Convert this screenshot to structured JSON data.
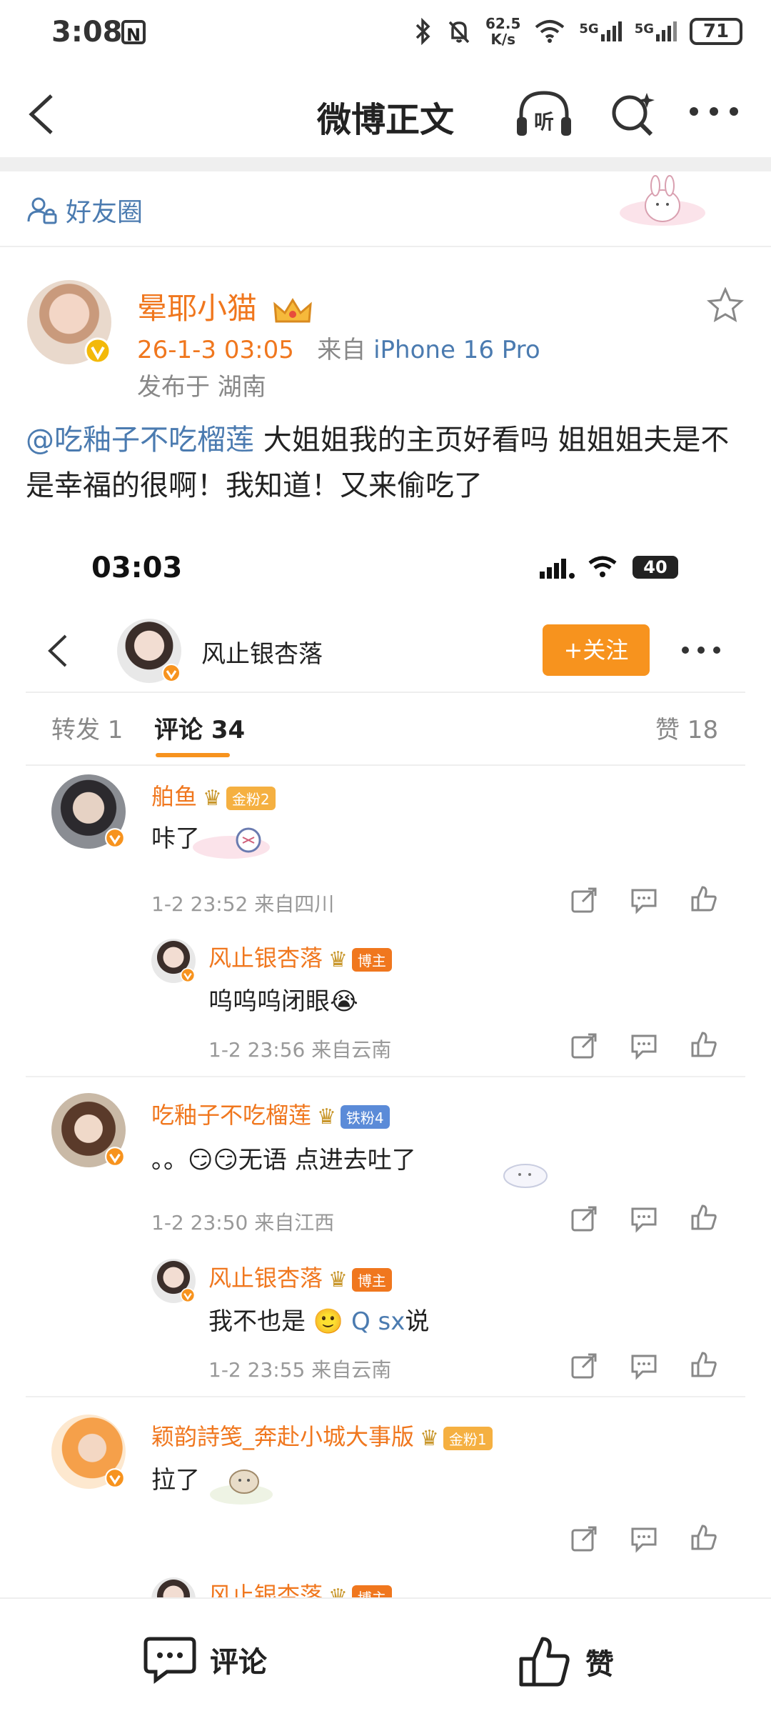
{
  "status_bar": {
    "time": "3:08",
    "n_icon": "N",
    "speed_top": "62.5",
    "speed_bottom": "K/s",
    "net1": "5G",
    "net2": "5G",
    "battery": "71"
  },
  "header": {
    "title": "微博正文"
  },
  "circle": {
    "label": "好友圈"
  },
  "post": {
    "author": "晕耶小猫",
    "time": "26-1-3 03:05",
    "source_prefix": "来自",
    "device": "iPhone 16 Pro",
    "location": "发布于 湖南",
    "mention": "@吃釉子不吃榴莲",
    "text": " 大姐姐我的主页好看吗 姐姐姐夫是不是幸福的很啊！我知道！又来偷吃了"
  },
  "embedded": {
    "time": "03:03",
    "battery": "40",
    "profile_name": "风止银杏落",
    "follow_label": "+关注",
    "tabs": {
      "repost": "转发 1",
      "comments": "评论 34",
      "likes": "赞 18"
    },
    "comments": [
      {
        "name": "舶鱼",
        "badge": "金粉2",
        "text": "咔了",
        "time": "1-2 23:52 来自四川",
        "reply": {
          "name": "风止银杏落",
          "badge": "博主",
          "text": "呜呜呜闭眼😭",
          "time": "1-2 23:56 来自云南"
        }
      },
      {
        "name": "吃釉子不吃榴莲",
        "badge": "铁粉4",
        "text": "。。😏😏无语 点进去吐了",
        "time": "1-2 23:50 来自江西",
        "reply": {
          "name": "风止银杏落",
          "badge": "博主",
          "text_prefix": "我不也是 🙂 ",
          "search": "Q sx",
          "text_suffix": "说",
          "time": "1-2 23:55 来自云南"
        }
      },
      {
        "name": "颖韵詩笺_奔赴小城大事版",
        "badge": "金粉1",
        "text": "拉了",
        "reply_partial_name": "风止银杏落",
        "reply_badge": "博主"
      }
    ]
  },
  "bottom_bar": {
    "comment_label": "评论",
    "like_label": "赞"
  }
}
